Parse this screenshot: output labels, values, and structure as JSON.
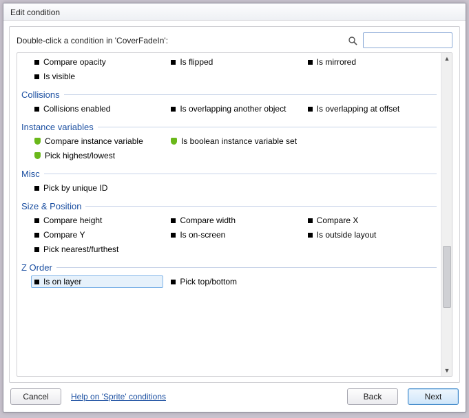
{
  "window": {
    "title": "Edit condition"
  },
  "prompt": "Double-click a condition in 'CoverFadeIn':",
  "search": {
    "placeholder": ""
  },
  "sections": [
    {
      "title": null,
      "items": [
        {
          "icon": "black",
          "label": "Compare opacity",
          "selected": false
        },
        {
          "icon": "black",
          "label": "Is flipped",
          "selected": false
        },
        {
          "icon": "black",
          "label": "Is mirrored",
          "selected": false
        },
        {
          "icon": "black",
          "label": "Is visible",
          "selected": false
        }
      ]
    },
    {
      "title": "Collisions",
      "items": [
        {
          "icon": "black",
          "label": "Collisions enabled",
          "selected": false
        },
        {
          "icon": "black",
          "label": "Is overlapping another object",
          "selected": false
        },
        {
          "icon": "black",
          "label": "Is overlapping at offset",
          "selected": false
        }
      ]
    },
    {
      "title": "Instance variables",
      "items": [
        {
          "icon": "green",
          "label": "Compare instance variable",
          "selected": false
        },
        {
          "icon": "green",
          "label": "Is boolean instance variable set",
          "selected": false
        },
        {
          "icon": "none",
          "label": "",
          "selected": false
        },
        {
          "icon": "green",
          "label": "Pick highest/lowest",
          "selected": false
        }
      ]
    },
    {
      "title": "Misc",
      "items": [
        {
          "icon": "black",
          "label": "Pick by unique ID",
          "selected": false
        }
      ]
    },
    {
      "title": "Size & Position",
      "items": [
        {
          "icon": "black",
          "label": "Compare height",
          "selected": false
        },
        {
          "icon": "black",
          "label": "Compare width",
          "selected": false
        },
        {
          "icon": "black",
          "label": "Compare X",
          "selected": false
        },
        {
          "icon": "black",
          "label": "Compare Y",
          "selected": false
        },
        {
          "icon": "black",
          "label": "Is on-screen",
          "selected": false
        },
        {
          "icon": "black",
          "label": "Is outside layout",
          "selected": false
        },
        {
          "icon": "black",
          "label": "Pick nearest/furthest",
          "selected": false
        }
      ]
    },
    {
      "title": "Z Order",
      "items": [
        {
          "icon": "black",
          "label": "Is on layer",
          "selected": true
        },
        {
          "icon": "black",
          "label": "Pick top/bottom",
          "selected": false
        }
      ]
    }
  ],
  "footer": {
    "cancel": "Cancel",
    "help": "Help on 'Sprite' conditions",
    "back": "Back",
    "next": "Next"
  }
}
